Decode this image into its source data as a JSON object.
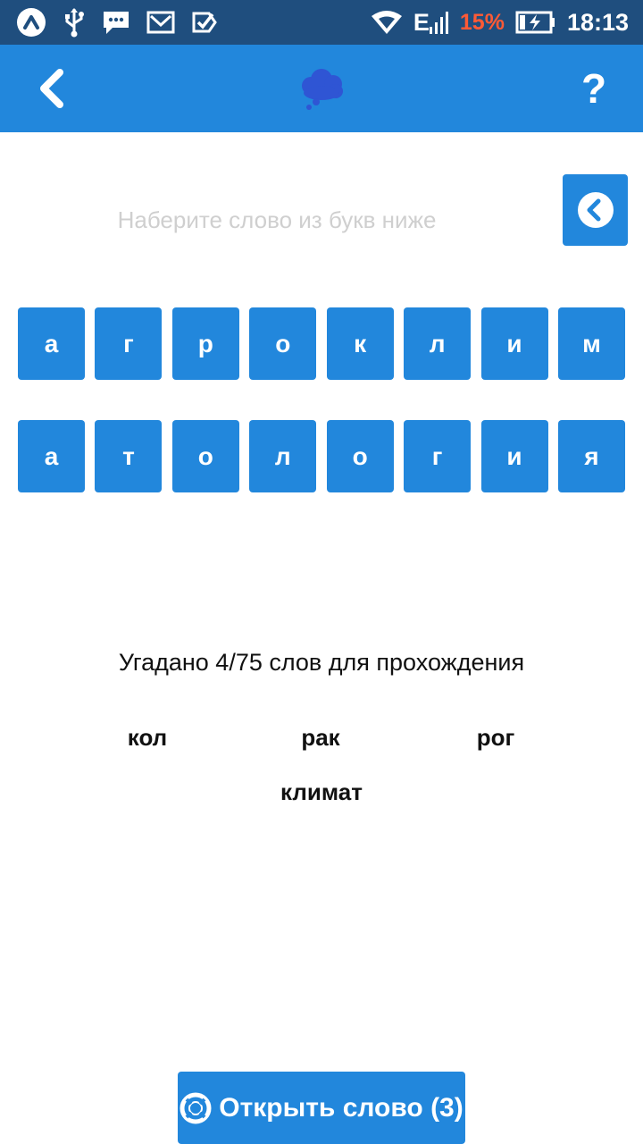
{
  "status_bar": {
    "time": "18:13",
    "battery_percent": "15%",
    "network_type": "E",
    "battery_color": "#ff5a36",
    "icons": [
      "app-icon",
      "usb-icon",
      "message-icon",
      "mail-icon",
      "check-icon",
      "wifi-icon",
      "signal-icon",
      "battery-charging-icon"
    ]
  },
  "app_bar": {
    "icons": [
      "back-arrow-icon",
      "thought-cloud-icon",
      "help-icon"
    ],
    "help_label": "?",
    "color": "#2287dc"
  },
  "input": {
    "placeholder": "Наберите слово из букв ниже"
  },
  "letters": {
    "row1": [
      "а",
      "г",
      "р",
      "о",
      "к",
      "л",
      "и",
      "м"
    ],
    "row2": [
      "а",
      "т",
      "о",
      "л",
      "о",
      "г",
      "и",
      "я"
    ]
  },
  "progress": {
    "text": "Угадано 4/75 слов для прохождения",
    "guessed": 4,
    "total": 75
  },
  "found_words": [
    "кол",
    "рак",
    "рог",
    "климат"
  ],
  "hint_button": {
    "label": "Открыть слово (3)",
    "icon": "lifebuoy-icon"
  }
}
